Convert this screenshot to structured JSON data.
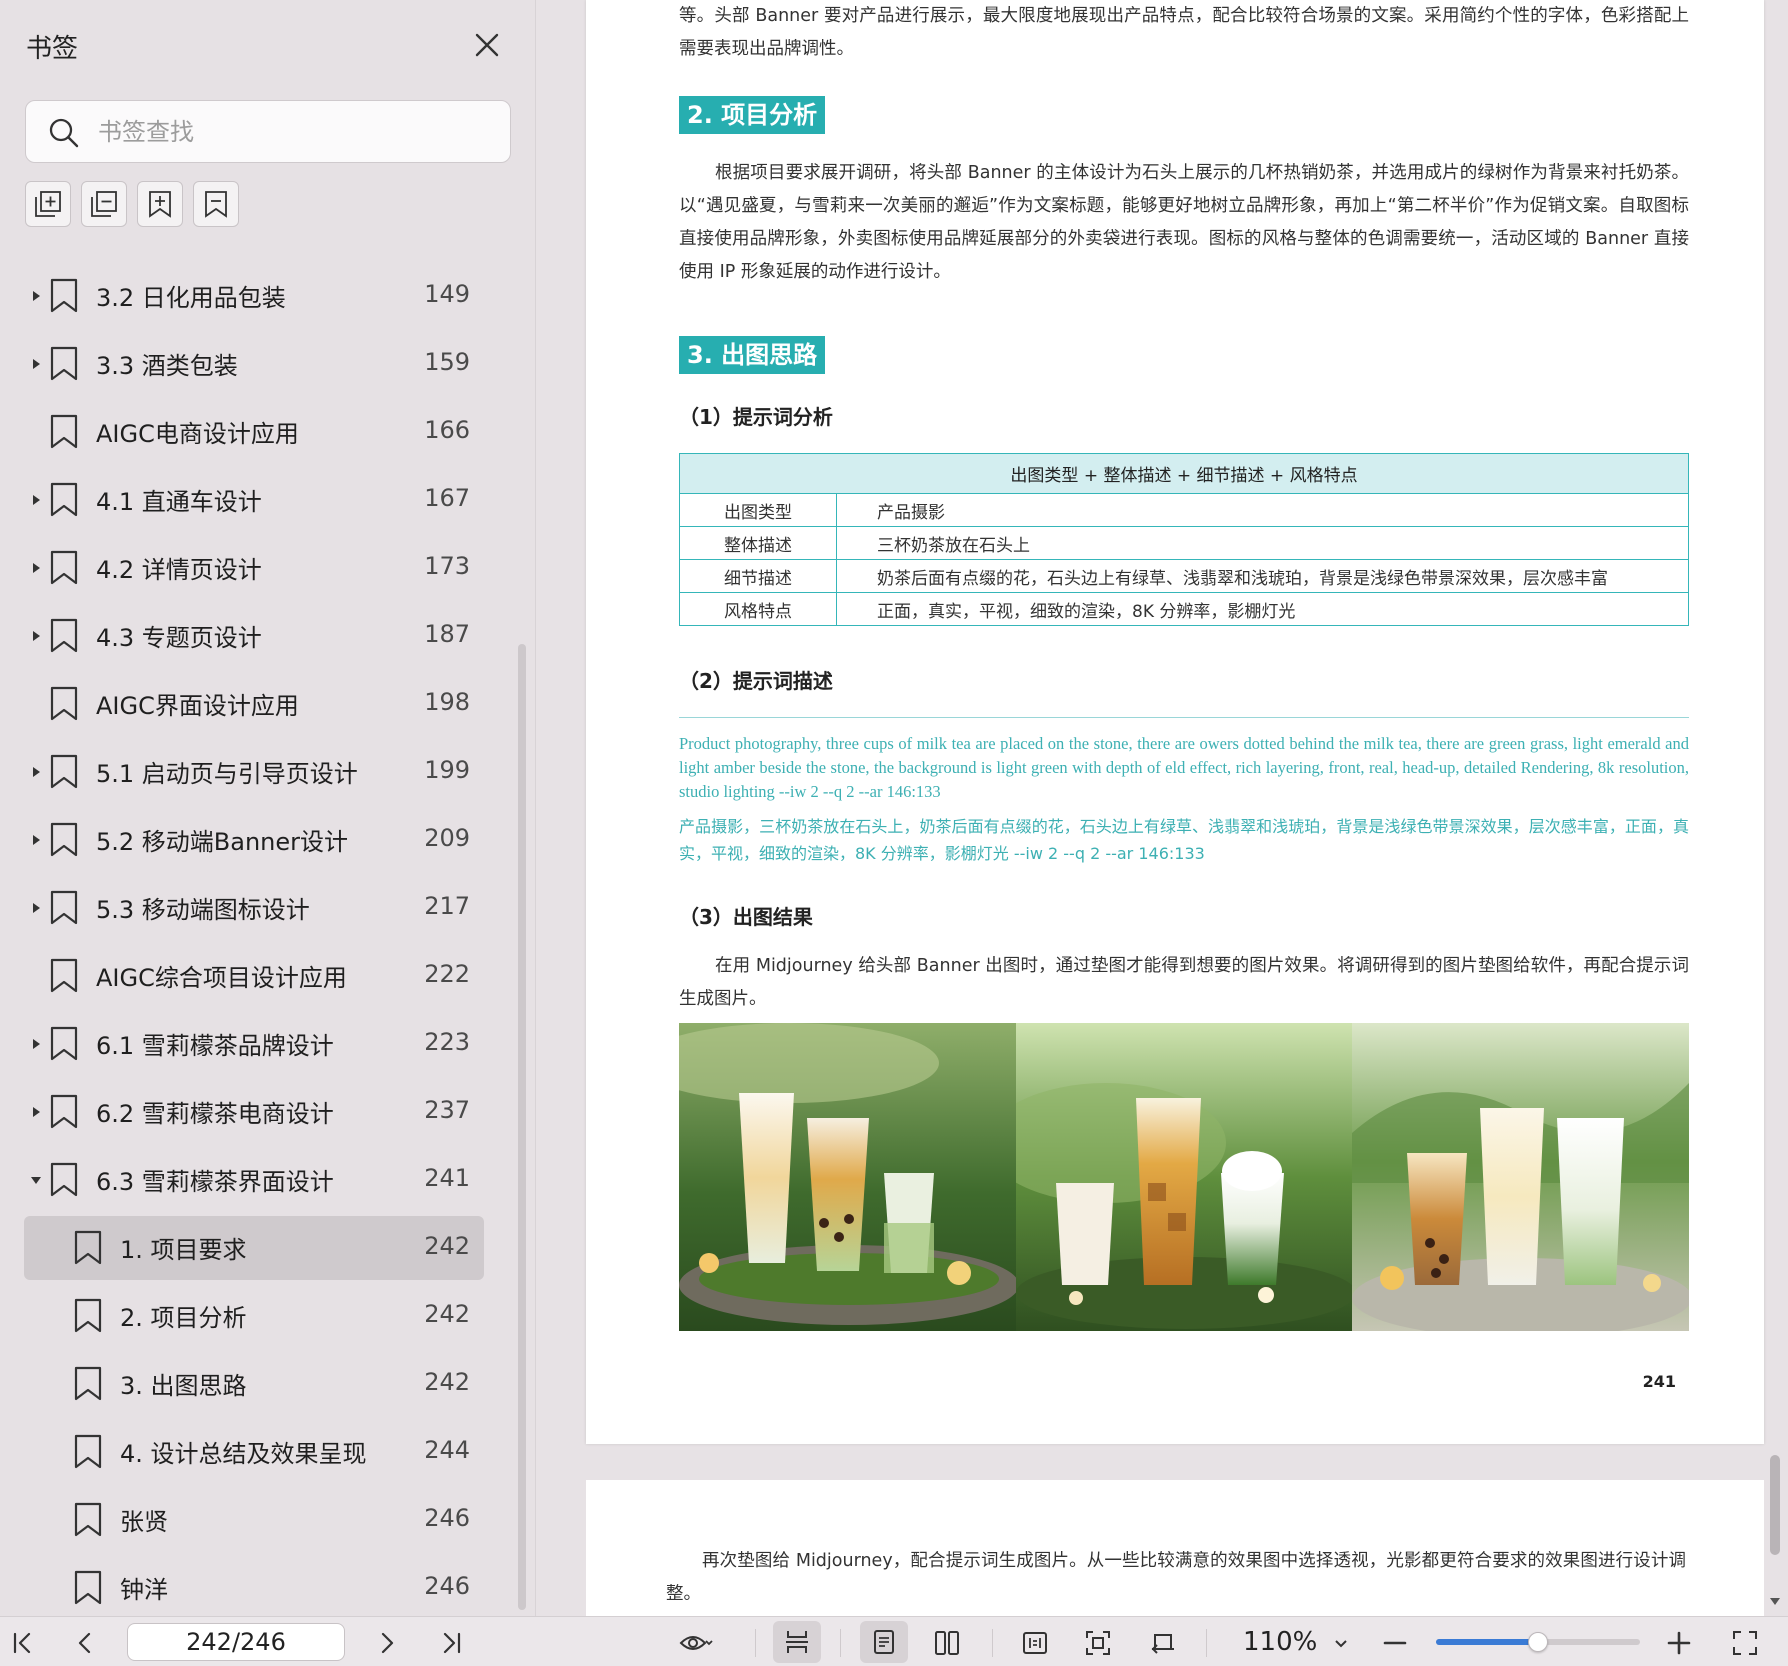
{
  "sidebar": {
    "title": "书签",
    "search_placeholder": "书签查找",
    "tools": [
      "add-bookmark-icon",
      "collapse-all-icon",
      "bookmark-add-icon",
      "bookmark-icon"
    ],
    "items": [
      {
        "label": "3.2 日化用品包装",
        "page": "149",
        "level": 0,
        "expandable": true,
        "expanded": false
      },
      {
        "label": "3.3 酒类包装",
        "page": "159",
        "level": 0,
        "expandable": true,
        "expanded": false
      },
      {
        "label": "AIGC电商设计应用",
        "page": "166",
        "level": 0,
        "expandable": false
      },
      {
        "label": "4.1 直通车设计",
        "page": "167",
        "level": 0,
        "expandable": true,
        "expanded": false
      },
      {
        "label": "4.2 详情页设计",
        "page": "173",
        "level": 0,
        "expandable": true,
        "expanded": false
      },
      {
        "label": "4.3 专题页设计",
        "page": "187",
        "level": 0,
        "expandable": true,
        "expanded": false
      },
      {
        "label": "AIGC界面设计应用",
        "page": "198",
        "level": 0,
        "expandable": false
      },
      {
        "label": "5.1 启动页与引导页设计",
        "page": "199",
        "level": 0,
        "expandable": true,
        "expanded": false
      },
      {
        "label": "5.2 移动端Banner设计",
        "page": "209",
        "level": 0,
        "expandable": true,
        "expanded": false
      },
      {
        "label": "5.3 移动端图标设计",
        "page": "217",
        "level": 0,
        "expandable": true,
        "expanded": false
      },
      {
        "label": "AIGC综合项目设计应用",
        "page": "222",
        "level": 0,
        "expandable": false
      },
      {
        "label": "6.1 雪莉檬茶品牌设计",
        "page": "223",
        "level": 0,
        "expandable": true,
        "expanded": false
      },
      {
        "label": "6.2 雪莉檬茶电商设计",
        "page": "237",
        "level": 0,
        "expandable": true,
        "expanded": false
      },
      {
        "label": "6.3 雪莉檬茶界面设计",
        "page": "241",
        "level": 0,
        "expandable": true,
        "expanded": true
      },
      {
        "label": "1. 项目要求",
        "page": "242",
        "level": 1,
        "expandable": false,
        "selected": true
      },
      {
        "label": "2. 项目分析",
        "page": "242",
        "level": 1,
        "expandable": false
      },
      {
        "label": "3. 出图思路",
        "page": "242",
        "level": 1,
        "expandable": false
      },
      {
        "label": "4. 设计总结及效果呈现",
        "page": "244",
        "level": 1,
        "expandable": false
      },
      {
        "label": "张贤",
        "page": "246",
        "level": 1,
        "expandable": false
      },
      {
        "label": "钟洋",
        "page": "246",
        "level": 1,
        "expandable": false
      }
    ]
  },
  "doc": {
    "intro_text": "等。头部 Banner 要对产品进行展示，最大限度地展现出产品特点，配合比较符合场景的文案。采用简约个性的字体，色彩搭配上需要表现出品牌调性。",
    "section2_title": "2. 项目分析",
    "section2_text": "根据项目要求展开调研，将头部 Banner 的主体设计为石头上展示的几杯热销奶茶，并选用成片的绿树作为背景来衬托奶茶。以“遇见盛夏，与雪莉来一次美丽的邂逅”作为文案标题，能够更好地树立品牌形象，再加上“第二杯半价”作为促销文案。自取图标直接使用品牌形象，外卖图标使用品牌延展部分的外卖袋进行表现。图标的风格与整体的色调需要统一，活动区域的 Banner 直接使用 IP 形象延展的动作进行设计。",
    "section3_title": "3. 出图思路",
    "sub1_title": "（1）提示词分析",
    "table": {
      "header": "出图类型 + 整体描述 + 细节描述 + 风格特点",
      "rows": [
        {
          "key": "出图类型",
          "value": "产品摄影"
        },
        {
          "key": "整体描述",
          "value": "三杯奶茶放在石头上"
        },
        {
          "key": "细节描述",
          "value": "奶茶后面有点缀的花，石头边上有绿草、浅翡翠和浅琥珀，背景是浅绿色带景深效果，层次感丰富"
        },
        {
          "key": "风格特点",
          "value": "正面，真实，平视，细致的渲染，8K 分辨率，影棚灯光"
        }
      ]
    },
    "sub2_title": "（2）提示词描述",
    "prompt_en": "Product photography, three cups of milk tea are placed on the stone, there are   owers dotted behind the milk tea, there are green grass, light emerald and light amber beside the stone, the background is light green with depth of   eld effect, rich layering, front, real, head-up, detailed Rendering, 8k resolution, studio lighting --iw 2 --q 2 --ar 146:133",
    "prompt_cn": "产品摄影，三杯奶茶放在石头上，奶茶后面有点缀的花，石头边上有绿草、浅翡翠和浅琥珀，背景是浅绿色带景深效果，层次感丰富，正面，真实，平视，细致的渲染，8K 分辨率，影棚灯光 --iw 2 --q 2 --ar 146:133",
    "sub3_title": "（3）出图结果",
    "result_text": "在用 Midjourney 给头部 Banner 出图时，通过垫图才能得到想要的图片效果。将调研得到的图片垫图给软件，再配合提示词生成图片。",
    "page_number": "241",
    "page2_text": "再次垫图给 Midjourney，配合提示词生成图片。从一些比较满意的效果图中选择透视，光影都更符合要求的效果图进行设计调整。"
  },
  "toolbar": {
    "page_indicator": "242/246",
    "zoom": "110%",
    "zoom_fraction": 0.5
  },
  "colors": {
    "accent_teal": "#27aeb0",
    "table_header": "#d3eef0",
    "selection": "#cfcacd",
    "slider_blue": "#3a7bd5"
  }
}
